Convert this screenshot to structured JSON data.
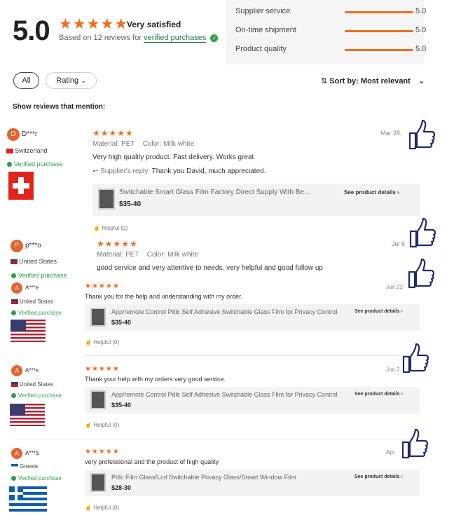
{
  "summary": {
    "score": "5.0",
    "stars": "★★★★★",
    "satisfaction": "Very satisfied",
    "based_on": "Based on 12 reviews for",
    "verified_link": "verified purchases"
  },
  "metrics": [
    {
      "label": "Supplier service",
      "value": "5.0",
      "fill": 1.0
    },
    {
      "label": "On-time shipment",
      "value": "5.0",
      "fill": 1.0
    },
    {
      "label": "Product quality",
      "value": "5.0",
      "fill": 1.0
    }
  ],
  "filters": {
    "all": "All",
    "rating": "Rating",
    "sort_prefix": "Sort by:",
    "sort_value": "Most relevant",
    "mention": "Show reviews that mention:"
  },
  "reviews": [
    {
      "initial": "D",
      "name": "D***r",
      "country": "Switzerland",
      "verified": "Verified purchase",
      "stars": "★★★★★",
      "date": "Mar 28,",
      "material_label": "Material:",
      "material": "PET",
      "color_label": "Color:",
      "color": "Milk white",
      "text": "Very high quality product. Fast delivery. Works great",
      "reply_label": "Supplier's reply:",
      "reply": "Thank you David, much appreciated.",
      "product_title": "Switchable Smart Glass Film Factory Direct Supply With Be...",
      "product_price": "$35-40",
      "product_link": "See product details",
      "helpful": "Helpful (0)"
    },
    {
      "initial": "P",
      "name": "p***o",
      "country": "United States",
      "verified": "Verified purchase",
      "stars": "★★★★★",
      "date": "Jul 6",
      "material_label": "Material:",
      "material": "PET",
      "color_label": "Color:",
      "color": "Milk white",
      "text": "good service and very attentive to needs. very helpful and good follow up"
    },
    {
      "initial": "A",
      "name": "A***e",
      "country": "United States",
      "verified": "Verified purchase",
      "stars": "★★★★★",
      "date": "Jun 22",
      "text": "Thank you for the help and understanding with my order.",
      "product_title": "App/remote Control Pdlc Self Adhesive Switchable Glass Film for Privacy Control",
      "product_price": "$35-40",
      "product_link": "See product details",
      "helpful": "Helpful (0)"
    },
    {
      "initial": "A",
      "name": "A***e",
      "country": "United States",
      "verified": "Verified purchase",
      "stars": "★★★★★",
      "date": "Jun 2",
      "text": "Thank your help with my orders very good service.",
      "product_title": "App/remote Control Pdlc Self Adhesive Switchable Glass Film for Privacy Control",
      "product_price": "$35-40",
      "product_link": "See product details",
      "helpful": "Helpful (0)"
    },
    {
      "initial": "A",
      "name": "A***S",
      "country": "Greece",
      "verified": "Verified purchase",
      "stars": "★★★★★",
      "date": "Apr",
      "text": "very professional and the product of high quality",
      "product_title": "Pdlc Film Glass/Lcd Switchable Privacy Glass/Smart Window Film",
      "product_price": "$28-30",
      "product_link": "See product details",
      "helpful": "Helpful (0)"
    }
  ],
  "colors": {
    "accent": "#f26b1d",
    "verified": "#2e9e4b",
    "avatar": "#e8622d",
    "thumb_icon": "#1f2a6b"
  },
  "icons": [
    "shield-check-icon",
    "chevron-down-icon",
    "sort-icon",
    "reply-icon",
    "thumbs-up-icon",
    "helpful-icon",
    "chevron-right-icon"
  ]
}
